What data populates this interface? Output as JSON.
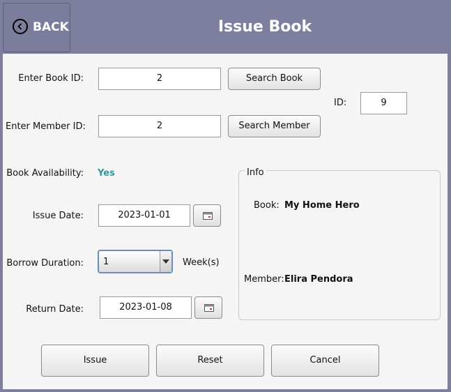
{
  "header": {
    "back_label": "BACK",
    "title": "Issue Book"
  },
  "form": {
    "book_id_label": "Enter Book ID:",
    "book_id_value": "2",
    "search_book_label": "Search Book",
    "id_label": "ID:",
    "id_value": "9",
    "member_id_label": "Enter Member ID:",
    "member_id_value": "2",
    "search_member_label": "Search Member",
    "availability_label": "Book Availability:",
    "availability_value": "Yes",
    "issue_date_label": "Issue Date:",
    "issue_date_value": "2023-01-01",
    "borrow_duration_label": "Borrow Duration:",
    "borrow_duration_value": "1",
    "borrow_unit": "Week(s)",
    "return_date_label": "Return Date:",
    "return_date_value": "2023-01-08"
  },
  "info": {
    "title": "Info",
    "book_label": "Book:",
    "book_value": "My Home Hero",
    "member_label": "Member:",
    "member_value": "Elira Pendora"
  },
  "actions": {
    "issue_label": "Issue",
    "reset_label": "Reset",
    "cancel_label": "Cancel"
  },
  "colors": {
    "header_bg": "#7e7e9e",
    "panel_bg": "#f5f5f5",
    "availability_yes": "#2a9c9c"
  },
  "icons": {
    "back": "circle-chevron-left-icon",
    "calendar": "calendar-icon",
    "dropdown": "chevron-down-icon"
  }
}
